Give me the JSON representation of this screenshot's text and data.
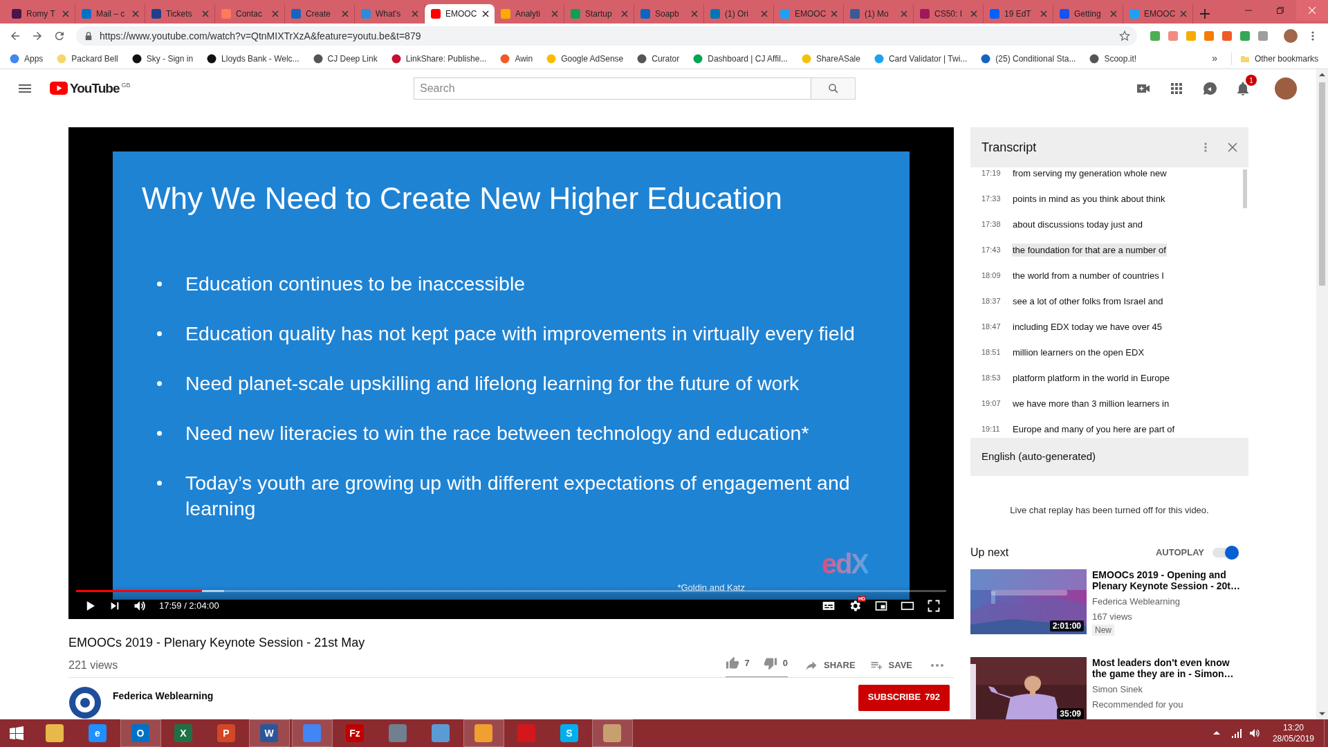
{
  "browser": {
    "tabs": [
      {
        "label": "Romy T",
        "color": "#4a154b",
        "selected": false
      },
      {
        "label": "Mail – c",
        "color": "#0072c6",
        "selected": false
      },
      {
        "label": "Tickets",
        "color": "#1d3f8f",
        "selected": false
      },
      {
        "label": "Contac",
        "color": "#ff7a59",
        "selected": false
      },
      {
        "label": "Create",
        "color": "#1565c0",
        "selected": false
      },
      {
        "label": "What's",
        "color": "#2a8dd8",
        "selected": false
      },
      {
        "label": "EMOOC",
        "color": "#ff0000",
        "selected": true
      },
      {
        "label": "Analyti",
        "color": "#f9ab00",
        "selected": false
      },
      {
        "label": "Startup",
        "color": "#0f9d58",
        "selected": false
      },
      {
        "label": "Soapb",
        "color": "#0a66c2",
        "selected": false
      },
      {
        "label": "(1) Ori",
        "color": "#0077b5",
        "selected": false
      },
      {
        "label": "EMOOC",
        "color": "#1da1f2",
        "selected": false
      },
      {
        "label": "(1) Mo",
        "color": "#3b5998",
        "selected": false
      },
      {
        "label": "CS50: I",
        "color": "#a0185c",
        "selected": false
      },
      {
        "label": "19 EdT",
        "color": "#0061ff",
        "selected": false
      },
      {
        "label": "Getting",
        "color": "#1652f0",
        "selected": false
      },
      {
        "label": "EMOOC",
        "color": "#1da1f2",
        "selected": false
      }
    ],
    "address": "https://www.youtube.com/watch?v=QtnMIXTrXzA&feature=youtu.be&t=879",
    "bookmarks": [
      {
        "label": "Apps",
        "color": "#4285f4"
      },
      {
        "label": "Packard Bell",
        "color": "#f5d76e"
      },
      {
        "label": "Sky - Sign in",
        "color": "#111111"
      },
      {
        "label": "Lloyds Bank - Welc...",
        "color": "#111111"
      },
      {
        "label": "CJ Deep Link",
        "color": "#555555"
      },
      {
        "label": "LinkShare: Publishe...",
        "color": "#c8102e"
      },
      {
        "label": "Awin",
        "color": "#f05a28"
      },
      {
        "label": "Google AdSense",
        "color": "#fbbc04"
      },
      {
        "label": "Curator",
        "color": "#555555"
      },
      {
        "label": "Dashboard | CJ Affil...",
        "color": "#00a651"
      },
      {
        "label": "ShareASale",
        "color": "#f4c20d"
      },
      {
        "label": "Card Validator | Twi...",
        "color": "#1da1f2"
      },
      {
        "label": "(25) Conditional Sta...",
        "color": "#1565c0"
      },
      {
        "label": "Scoop.it!",
        "color": "#555555"
      }
    ],
    "more_bookmarks": "»",
    "other_bookmarks": "Other bookmarks"
  },
  "youtube": {
    "logo": "YouTube",
    "region": "GB",
    "search": {
      "placeholder": "Search"
    },
    "notifications": "1"
  },
  "video": {
    "slide": {
      "title": "Why We Need to Create New Higher Education",
      "bullets": [
        "Education continues to be inaccessible",
        "Education quality has not kept pace with improvements in virtually every field",
        "Need planet-scale upskilling and lifelong learning for the future of work",
        "Need new literacies to win the race between technology and education*",
        "Today’s youth are growing up with different expectations of engagement and learning"
      ],
      "footnote": "*Goldin and Katz",
      "logo": "edX"
    },
    "progress": {
      "level": 0.145
    },
    "time": "17:59 / 2:04:00",
    "hd": "HD",
    "title": "EMOOCs 2019 - Plenary Keynote Session - 21st May",
    "views": "221 views",
    "likes": "7",
    "dislikes": "0",
    "share": "SHARE",
    "save": "SAVE"
  },
  "channel": {
    "name": "Federica Weblearning",
    "subscribe": "SUBSCRIBE",
    "subscribers": "792"
  },
  "transcript": {
    "title": "Transcript",
    "rows": [
      {
        "time": "17:19",
        "text": "from serving my generation whole new",
        "selected": false
      },
      {
        "time": "17:33",
        "text": "points in mind as you think about think",
        "selected": false
      },
      {
        "time": "17:38",
        "text": "about discussions today just and",
        "selected": false
      },
      {
        "time": "17:43",
        "text": "the foundation for that are a number of",
        "selected": true
      },
      {
        "time": "18:09",
        "text": "the world from a number of countries I",
        "selected": false
      },
      {
        "time": "18:37",
        "text": "see a lot of other folks from Israel and",
        "selected": false
      },
      {
        "time": "18:47",
        "text": "including EDX today we have over 45",
        "selected": false
      },
      {
        "time": "18:51",
        "text": "million learners on the open EDX",
        "selected": false
      },
      {
        "time": "18:53",
        "text": "platform platform in the world in Europe",
        "selected": false
      },
      {
        "time": "19:07",
        "text": "we have more than 3 million learners in",
        "selected": false
      },
      {
        "time": "19:11",
        "text": "Europe and many of you here are part of",
        "selected": false
      }
    ],
    "language": "English (auto-generated)"
  },
  "live_chat": "Live chat replay has been turned off for this video.",
  "up_next": {
    "title": "Up next",
    "autoplay": {
      "label": "AUTOPLAY",
      "on": true
    },
    "videos": [
      {
        "title": "EMOOCs 2019 - Opening and Plenary Keynote Session - 20t…",
        "channel": "Federica Weblearning",
        "meta": "167 views",
        "badge": "New",
        "duration": "2:01:00"
      },
      {
        "title": "Most leaders don't even know the game they are in - Simon…",
        "channel": "Simon Sinek",
        "meta": "Recommended for you",
        "duration": "35:09"
      }
    ]
  },
  "taskbar": {
    "apps": [
      {
        "color": "#e8b84a",
        "open": false
      },
      {
        "color": "#1e90ff",
        "open": false,
        "glyph": "e"
      },
      {
        "color": "#0072c6",
        "open": true,
        "glyph": "O"
      },
      {
        "color": "#1e7145",
        "open": false,
        "glyph": "X"
      },
      {
        "color": "#d24726",
        "open": false,
        "glyph": "P"
      },
      {
        "color": "#2b579a",
        "open": true,
        "glyph": "W"
      },
      {
        "color": "#4285f4",
        "open": true
      },
      {
        "color": "#bf0000",
        "open": false,
        "glyph": "Fz"
      },
      {
        "color": "#708090",
        "open": false
      },
      {
        "color": "#5b9bd5",
        "open": false
      },
      {
        "color": "#f0a030",
        "open": true
      },
      {
        "color": "#d4161d",
        "open": false
      },
      {
        "color": "#00aff0",
        "open": false,
        "glyph": "S"
      },
      {
        "color": "#c8a070",
        "open": true
      }
    ],
    "time": "13:20",
    "date": "28/05/2019"
  }
}
